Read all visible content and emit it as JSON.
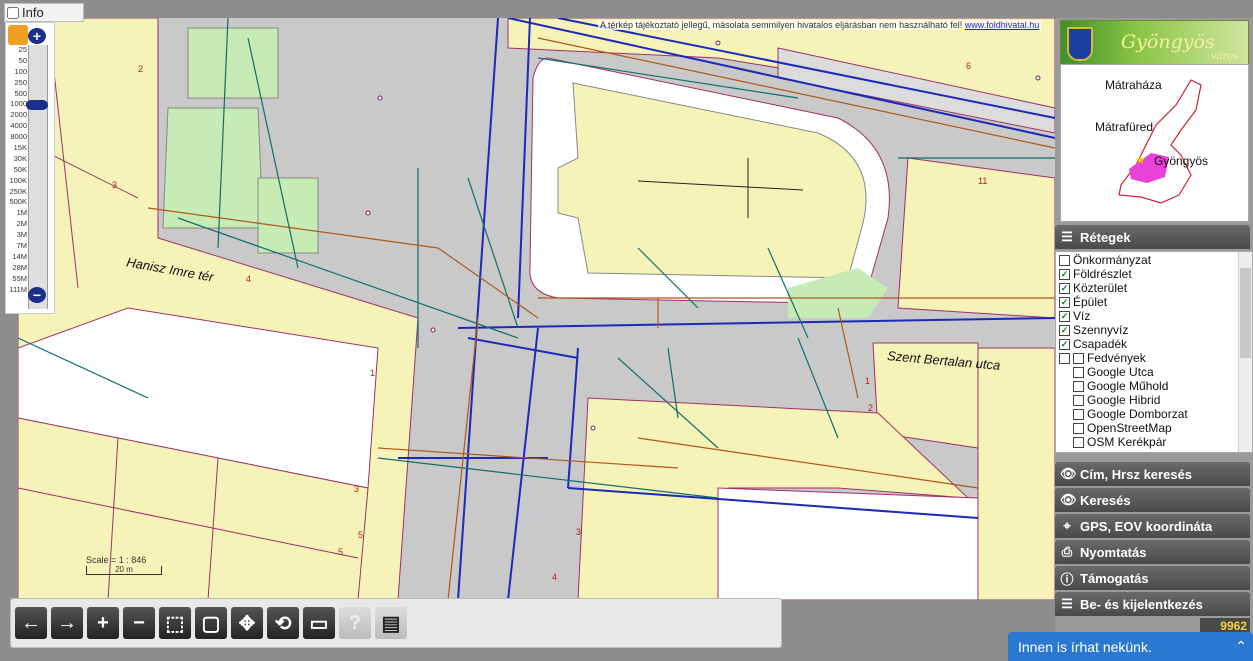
{
  "info": {
    "label": "Info"
  },
  "disclaimer": {
    "text": "A térkép tájékoztató jellegű, másolata semmilyen hivatalos eljárásban nem használható fel! ",
    "link": "www.foldhivatal.hu"
  },
  "zoom": {
    "levels": [
      "25",
      "50",
      "100",
      "250",
      "500",
      "1000",
      "2000",
      "4000",
      "8000",
      "15K",
      "30K",
      "50K",
      "100K",
      "250K",
      "500K",
      "1M",
      "2M",
      "3M",
      "7M",
      "14M",
      "28M",
      "55M",
      "111M"
    ],
    "current": "1000"
  },
  "map_labels": {
    "street1": "Hanisz Imre tér",
    "street2": "Szent Bertalan utca"
  },
  "lot_numbers": [
    "2",
    "3",
    "4",
    "5",
    "6",
    "11",
    "1",
    "3",
    "5",
    "4",
    "1",
    "2",
    "3"
  ],
  "scale": {
    "text": "Scale = 1 : 846",
    "bar": "20 m"
  },
  "toolbar": {
    "icons": [
      "arrow-left-icon",
      "arrow-right-icon",
      "zoom-in-icon",
      "zoom-out-icon",
      "zoom-box-icon",
      "full-extent-icon",
      "pan-icon",
      "refresh-icon",
      "measure-icon",
      "help-icon",
      "document-icon"
    ],
    "glyphs": [
      "←",
      "→",
      "+",
      "−",
      "⬚",
      "▢",
      "✥",
      "⟲",
      "▭",
      "?",
      "▤"
    ]
  },
  "logo": {
    "title": "Gyöngyös",
    "sub": "város"
  },
  "minimap": {
    "places": [
      "Mátraháza",
      "Mátrafüred",
      "Gyöngyös"
    ]
  },
  "sections": {
    "layers": "Rétegek",
    "address_search": "Cím, Hrsz keresés",
    "search": "Keresés",
    "gps": "GPS, EOV koordináta",
    "print": "Nyomtatás",
    "support": "Támogatás",
    "login": "Be- és kijelentkezés"
  },
  "layers": [
    {
      "label": "Önkormányzat",
      "checked": false,
      "indent": 0
    },
    {
      "label": "Földrészlet",
      "checked": true,
      "indent": 0
    },
    {
      "label": "Közterület",
      "checked": true,
      "indent": 0
    },
    {
      "label": "Épület",
      "checked": true,
      "indent": 0
    },
    {
      "label": "Víz",
      "checked": true,
      "indent": 0
    },
    {
      "label": "Szennyvíz",
      "checked": true,
      "indent": 0
    },
    {
      "label": "Csapadék",
      "checked": true,
      "indent": 0
    },
    {
      "label": "Fedvények",
      "checked": false,
      "indent": 1
    },
    {
      "label": "Google Utca",
      "checked": false,
      "indent": 2
    },
    {
      "label": "Google Műhold",
      "checked": false,
      "indent": 2
    },
    {
      "label": "Google Hibrid",
      "checked": false,
      "indent": 2
    },
    {
      "label": "Google Domborzat",
      "checked": false,
      "indent": 2
    },
    {
      "label": "OpenStreetMap",
      "checked": false,
      "indent": 2
    },
    {
      "label": "OSM Kerékpár",
      "checked": false,
      "indent": 2
    }
  ],
  "counter": "9962",
  "chat": {
    "label": "Innen is írhat nekünk.",
    "chevron": "⌃"
  },
  "colors": {
    "parcel": "#f6f3b8",
    "street": "#c9c9c9",
    "park": "#c7ebb5",
    "water": "#1d29b8",
    "sewer": "#0f6f6f",
    "storm": "#b0581a",
    "border": "#a0306a"
  }
}
